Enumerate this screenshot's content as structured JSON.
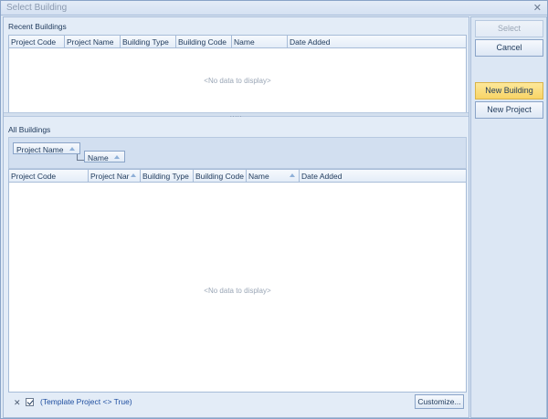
{
  "window": {
    "title": "Select Building",
    "close_glyph": "✕"
  },
  "recent": {
    "label": "Recent Buildings",
    "columns": [
      "Project Code",
      "Project Name",
      "Building Type",
      "Building Code",
      "Name",
      "Date Added"
    ],
    "empty_text": "<No data to display>"
  },
  "splitter": {
    "grip": "....."
  },
  "all": {
    "label": "All Buildings",
    "group_by": [
      "Project Name",
      "Name"
    ],
    "columns": [
      "Project Code",
      "Project Nar",
      "Building Type",
      "Building Code",
      "Name",
      "Date Added"
    ],
    "sorted_columns": [
      "Project Nar",
      "Name"
    ],
    "empty_text": "<No data to display>",
    "filter": {
      "clear_glyph": "✕",
      "checked": true,
      "text": "(Template Project <> True)"
    },
    "customize_label": "Customize..."
  },
  "buttons": {
    "select": "Select",
    "cancel": "Cancel",
    "new_building": "New Building",
    "new_project": "New Project"
  },
  "colors": {
    "accent": "#f8d466",
    "frame": "#dfe9f5",
    "border": "#a7bcd8"
  }
}
